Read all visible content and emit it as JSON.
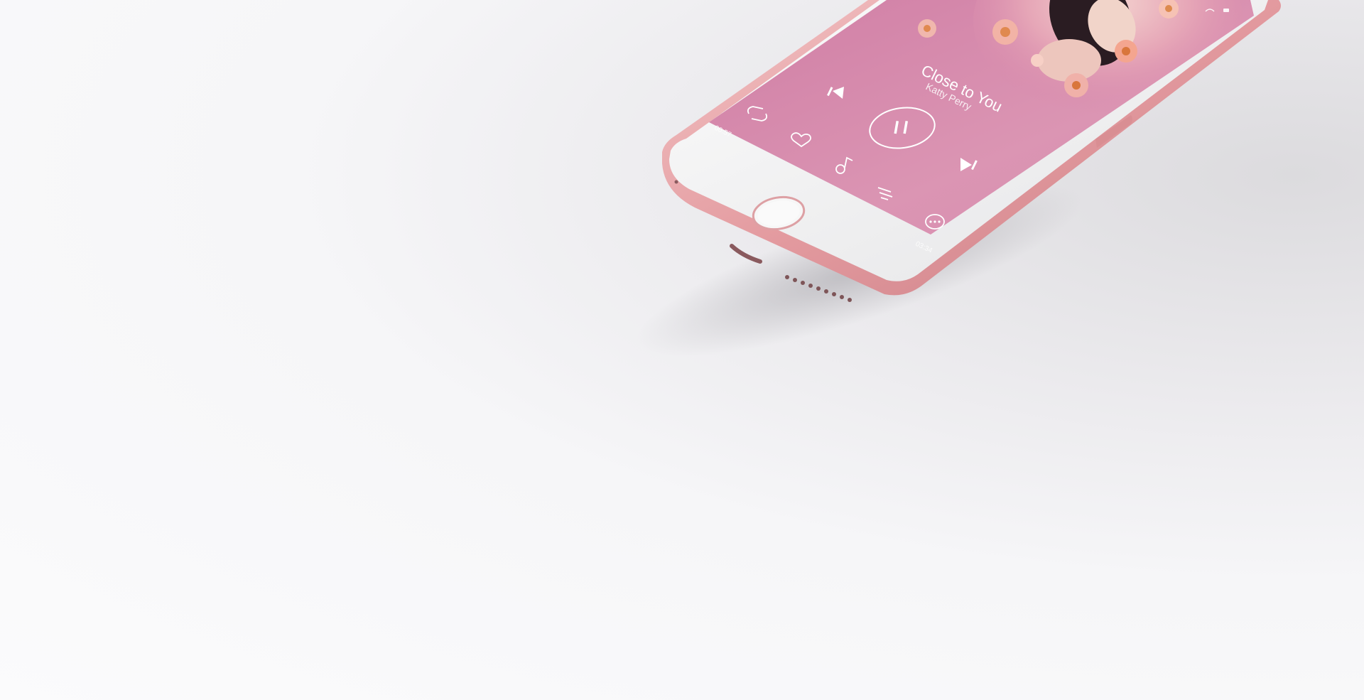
{
  "player": {
    "song_title": "Close to You",
    "artist": "Katty Perry",
    "elapsed_time": "00:57",
    "total_time": "03:34"
  },
  "icons": {
    "previous": "skip-previous-icon",
    "next": "skip-next-icon",
    "play_pause": "pause-icon",
    "repeat": "repeat-icon",
    "favorite": "heart-icon",
    "tone": "music-note-icon",
    "playlist": "playlist-icon",
    "more": "more-options-icon",
    "home": "home-button"
  },
  "colors": {
    "phone_body": "#e8a8ac",
    "screen_pink": "#d98fb0",
    "bezel": "#f2f2f3",
    "background": "#f4f4f6"
  }
}
